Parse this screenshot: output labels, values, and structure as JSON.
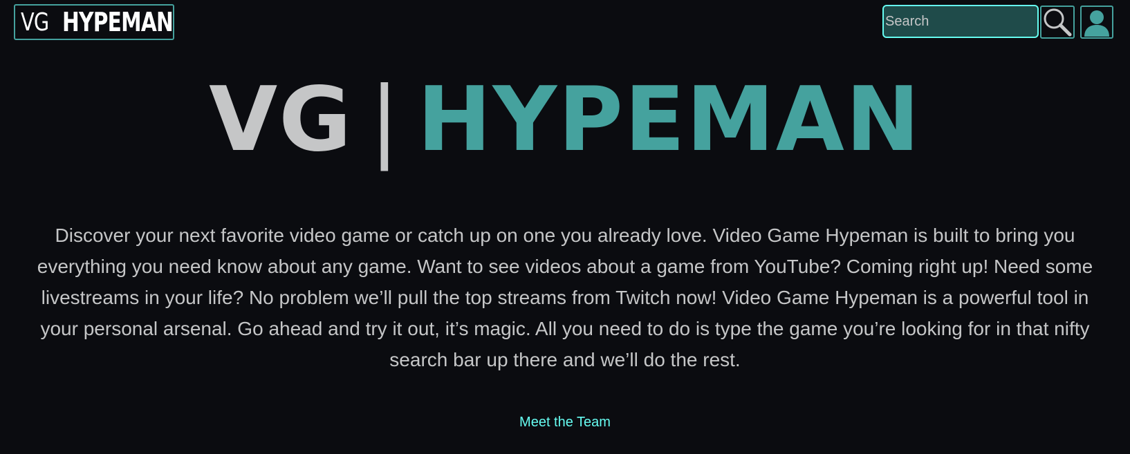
{
  "navbar": {
    "logo": {
      "vg": "VG",
      "hypeman": "HYPEMAN"
    },
    "search": {
      "placeholder": "Search"
    },
    "icons": {
      "search": "magnifier-icon",
      "user": "user-icon"
    }
  },
  "hero": {
    "title_vg": "VG",
    "title_sep": "|",
    "title_hypeman": "HYPEMAN",
    "description": "Discover your next favorite video game or catch up on one you already love. Video Game Hypeman is built to bring you everything you need know about any game. Want to see videos about a game from YouTube? Coming right up! Need some livestreams in your life? No problem we’ll pull the top streams from Twitch now! Video Game Hypeman is a powerful tool in your personal arsenal. Go ahead and try it out, it’s magic. All you need to do is type the game you’re looking for in that nifty search bar up there and we’ll do the rest."
  },
  "footer": {
    "team_link": "Meet the Team"
  },
  "colors": {
    "background": "#0b0c10",
    "accent": "#45a29e",
    "accent_light": "#66fcf1",
    "text": "#c5c6c7"
  }
}
